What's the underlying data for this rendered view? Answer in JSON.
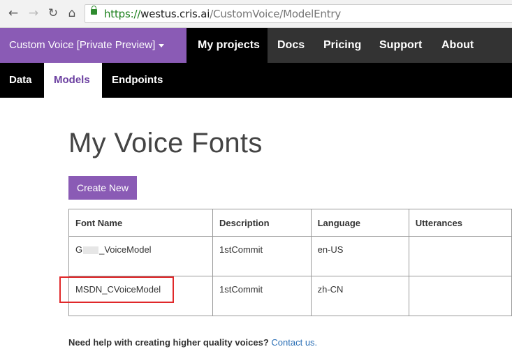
{
  "browser": {
    "url_scheme": "https://",
    "url_host": "westus.cris.ai",
    "url_path": "/CustomVoice/ModelEntry"
  },
  "topnav": {
    "brand": "Custom Voice [Private Preview]",
    "items": [
      "My projects",
      "Docs",
      "Pricing",
      "Support",
      "About"
    ]
  },
  "subnav": {
    "items": [
      "Data",
      "Models",
      "Endpoints"
    ]
  },
  "page": {
    "title": "My Voice Fonts",
    "create_button": "Create New"
  },
  "table": {
    "headers": [
      "Font Name",
      "Description",
      "Language",
      "Utterances"
    ],
    "rows": [
      {
        "font_name_prefix": "G",
        "font_name_suffix": "_VoiceModel",
        "description": "1stCommit",
        "language": "en-US",
        "utterances": ""
      },
      {
        "font_name": "MSDN_CVoiceModel",
        "description": "1stCommit",
        "language": "zh-CN",
        "utterances": ""
      }
    ]
  },
  "footer": {
    "help_text": "Need help with creating higher quality voices?",
    "contact_link": "Contact us."
  },
  "colors": {
    "brand_purple": "#8a5bb5",
    "nav_dark": "#333333",
    "highlight_red": "#e0282a",
    "link_blue": "#2b6fb5"
  }
}
